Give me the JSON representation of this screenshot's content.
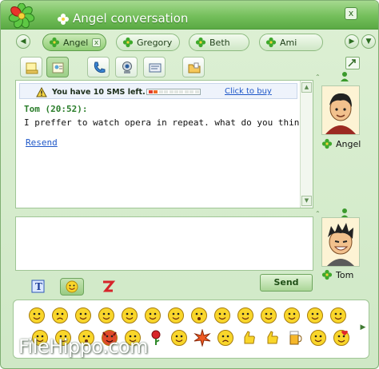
{
  "window": {
    "title": "Angel conversation",
    "close_label": "x"
  },
  "tabs": [
    {
      "label": "Angel",
      "active": true,
      "close": "x"
    },
    {
      "label": "Gregory",
      "active": false
    },
    {
      "label": "Beth",
      "active": false
    },
    {
      "label": "Ami",
      "active": false
    }
  ],
  "nav": {
    "left": "◀",
    "right": "▶",
    "down": "▼"
  },
  "toolbar": {
    "icons": [
      "notes-icon",
      "contact-card-icon",
      "phone-icon",
      "webcam-icon",
      "send-file-icon",
      "folder-icon"
    ]
  },
  "history": {
    "sms_text": "You have 10 SMS left.",
    "buy_link": "Click to buy",
    "sms_level": 0.15,
    "message_header": "Tom (20:52):",
    "message_body": "I preffer to watch opera in repeat. what do you think?",
    "resend": "Resend"
  },
  "contacts": {
    "remote_name": "Angel",
    "local_name": "Tom"
  },
  "compose": {
    "value": "",
    "send_label": "Send"
  },
  "format_tools": {
    "icons": [
      "text-format-icon",
      "smiley-icon",
      "zap-icon"
    ]
  },
  "emoticons": {
    "row1": [
      "smile",
      "sad",
      "laugh",
      "wink",
      "blush",
      "cool",
      "kiss",
      "surprised",
      "music",
      "angry",
      "tongue",
      "star-eyes",
      "shy",
      "confused"
    ],
    "row2": [
      "thinking",
      "nervous",
      "shocked",
      "devil",
      "grin",
      "rose",
      "sleepy",
      "burst",
      "worried",
      "thumbs-up",
      "fist",
      "beer",
      "sick",
      "love"
    ]
  },
  "watermark": "FileHippo.com",
  "colors": {
    "accent": "#74bf5b",
    "link": "#1e57c8",
    "timestamp_green": "#2a7d2a"
  }
}
